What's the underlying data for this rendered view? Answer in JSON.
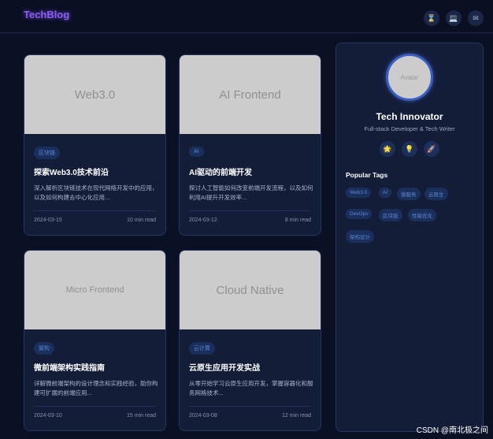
{
  "header": {
    "logo": "TechBlog",
    "buttons": [
      {
        "icon": "hourglass-icon",
        "glyph": "⌛"
      },
      {
        "icon": "laptop-icon",
        "glyph": "💻"
      },
      {
        "icon": "mail-icon",
        "glyph": "✉"
      }
    ]
  },
  "posts": [
    {
      "image_text": "Web3.0",
      "tag": "区块链",
      "title": "探索Web3.0技术前沿",
      "desc": "深入解析区块链技术在现代网络开发中的应用，以及如何构建去中心化应用...",
      "date": "2024-03-15",
      "read": "10 min read"
    },
    {
      "image_text": "AI Frontend",
      "tag": "AI",
      "title": "AI驱动的前端开发",
      "desc": "探讨人工智能如何改变前端开发流程，以及如何利用AI提升开发效率...",
      "date": "2024-03-12",
      "read": "8 min read"
    },
    {
      "image_text": "Micro Frontend",
      "tag": "架构",
      "title": "微前端架构实践指南",
      "desc": "详解微前端架构的设计理念和实践经验，助你构建可扩展的前端应用...",
      "date": "2024-03-10",
      "read": "15 min read"
    },
    {
      "image_text": "Cloud Native",
      "tag": "云计算",
      "title": "云原生应用开发实战",
      "desc": "从零开始学习云原生应用开发，掌握容器化和服务网格技术...",
      "date": "2024-03-08",
      "read": "12 min read"
    }
  ],
  "profile": {
    "avatar_text": "Avatar",
    "name": "Tech Innovator",
    "role": "Full-stack Developer & Tech Writer",
    "socials": [
      {
        "icon": "sun-icon",
        "glyph": "🌟"
      },
      {
        "icon": "lightbulb-icon",
        "glyph": "💡"
      },
      {
        "icon": "rocket-icon",
        "glyph": "🚀"
      }
    ]
  },
  "popular_tags": {
    "title": "Popular Tags",
    "tags": [
      "Web3.0",
      "AI",
      "微服务",
      "云原生",
      "DevOps",
      "区块链",
      "性能优化",
      "架构设计"
    ]
  },
  "watermark": "CSDN @南北极之间",
  "colors": {
    "accent": "#8a5cf6",
    "tag_bg": "#1b2f5c",
    "tag_text": "#5d87d8",
    "card_bg": "#141d38"
  }
}
